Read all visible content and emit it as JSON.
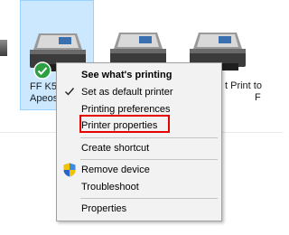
{
  "devices": [
    {
      "label_line1": "FF K5",
      "label_line2": "ApeosP",
      "selected": true,
      "is_default": true
    },
    {
      "label_line1": "",
      "label_line2": ""
    },
    {
      "label_line1": "t Print to",
      "label_line2": "F"
    }
  ],
  "context_menu": {
    "items": [
      {
        "label": "See what's printing",
        "bold": true
      },
      {
        "label": "Set as default printer",
        "checked": true
      },
      {
        "label": "Printing preferences"
      },
      {
        "label": "Printer properties",
        "highlighted": true
      },
      {
        "label": "Create shortcut"
      },
      {
        "label": "Remove device",
        "icon": "uac-shield-icon"
      },
      {
        "label": "Troubleshoot"
      },
      {
        "label": "Properties"
      }
    ]
  },
  "colors": {
    "selection_fill": "#cce8ff",
    "selection_border": "#99d1ff",
    "menu_background": "#f2f2f2",
    "highlight_border": "#e60000",
    "default_badge": "#2ea043"
  }
}
